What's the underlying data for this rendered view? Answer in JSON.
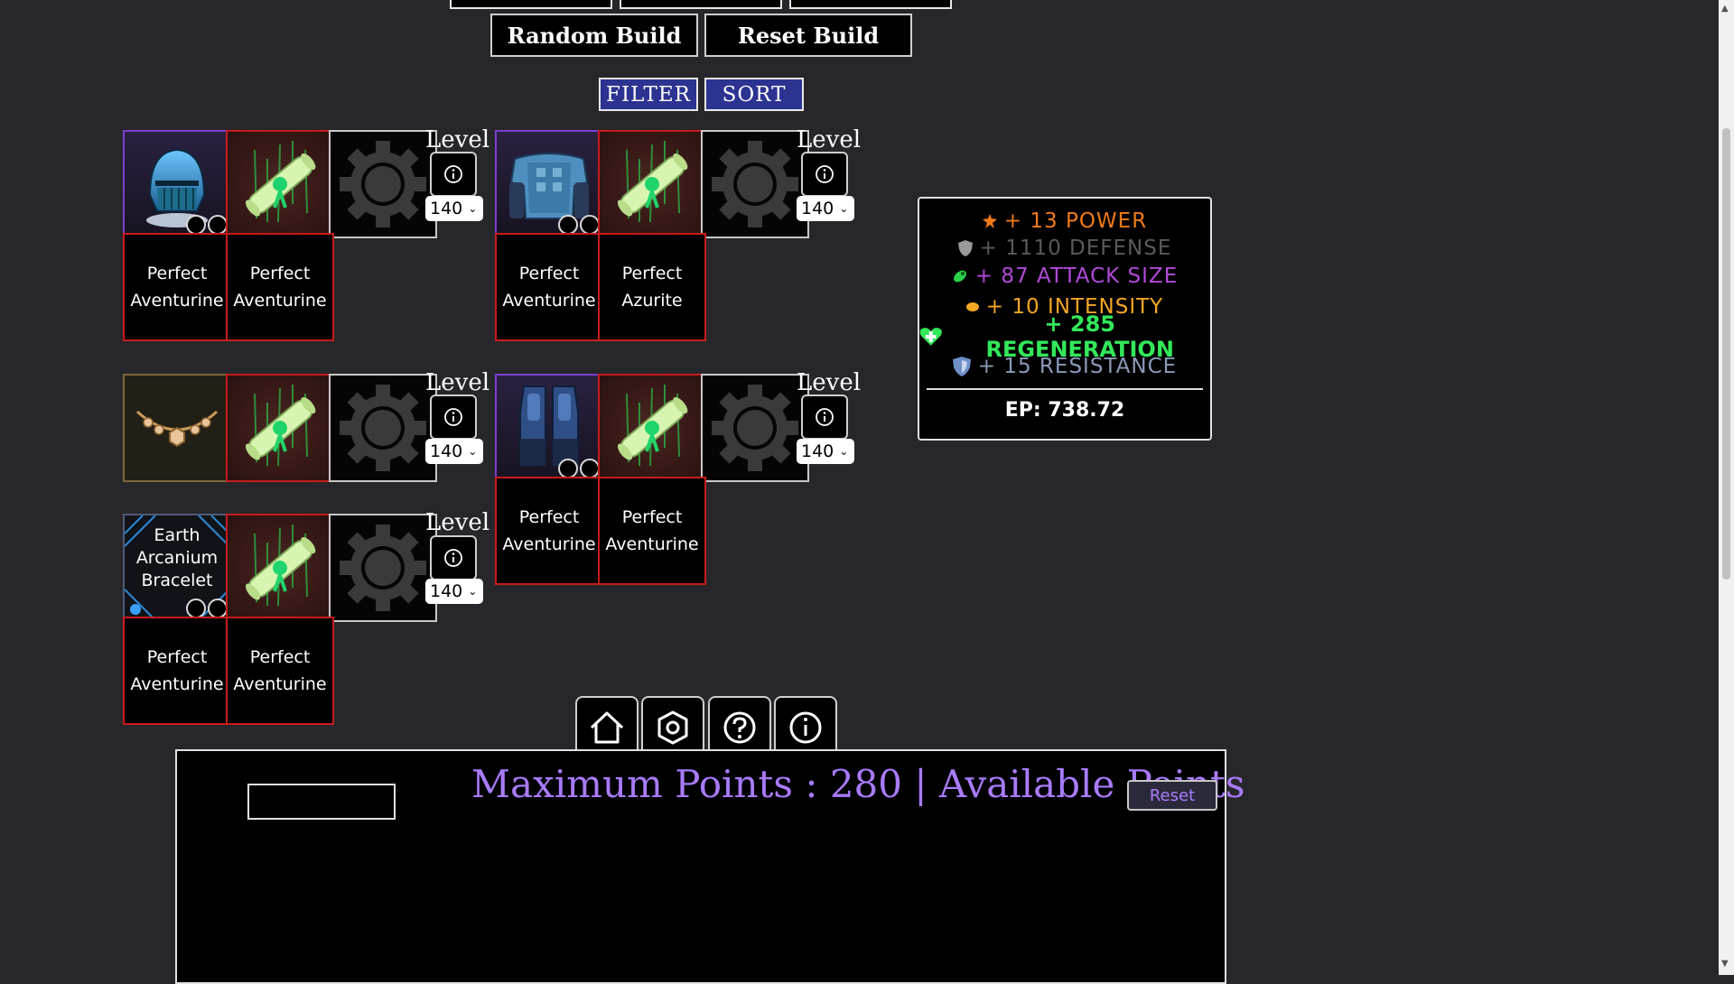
{
  "top": {
    "random_label": "Random Build",
    "reset_label": "Reset Build",
    "filter_label": "FILTER",
    "sort_label": "SORT"
  },
  "common": {
    "level_label": "Level",
    "level_value": "140"
  },
  "slot_names": {
    "helmet": "knight-helmet",
    "scroll": "enchant-scroll",
    "gear": "gear-icon",
    "chest": "chest-armor",
    "amulet": "amulet",
    "boots": "boots",
    "bracelet": "bracelet"
  },
  "items": {
    "bracelet_label": "Earth Arcanium Bracelet"
  },
  "gems": {
    "helmet": [
      "Perfect Aventurine",
      "Perfect Aventurine"
    ],
    "chest": [
      "Perfect Aventurine",
      "Perfect Azurite"
    ],
    "boots": [
      "Perfect Aventurine",
      "Perfect Aventurine"
    ],
    "bracelet": [
      "Perfect Aventurine",
      "Perfect Aventurine"
    ]
  },
  "stats": {
    "power": "+ 13 POWER",
    "defense": "+ 1110 DEFENSE",
    "attack_size": "+ 87 ATTACK SIZE",
    "intensity": "+ 10 INTENSITY",
    "regeneration": "+ 285 REGENERATION",
    "resistance": "+ 15 RESISTANCE",
    "ep": "EP: 738.72",
    "colors": {
      "power": "#f07a1a",
      "defense": "#5a5a5a",
      "attack_size": "#b04ad8",
      "intensity": "#f5a623",
      "regeneration": "#33e85a",
      "resistance": "#8a9ab8"
    }
  },
  "nav": {
    "icons": [
      "home-icon",
      "settings-icon",
      "help-icon",
      "info-icon"
    ]
  },
  "points": {
    "text": "Maximum Points : 280 | Available Points",
    "reset_label": "Reset",
    "color": "#a97bff"
  }
}
